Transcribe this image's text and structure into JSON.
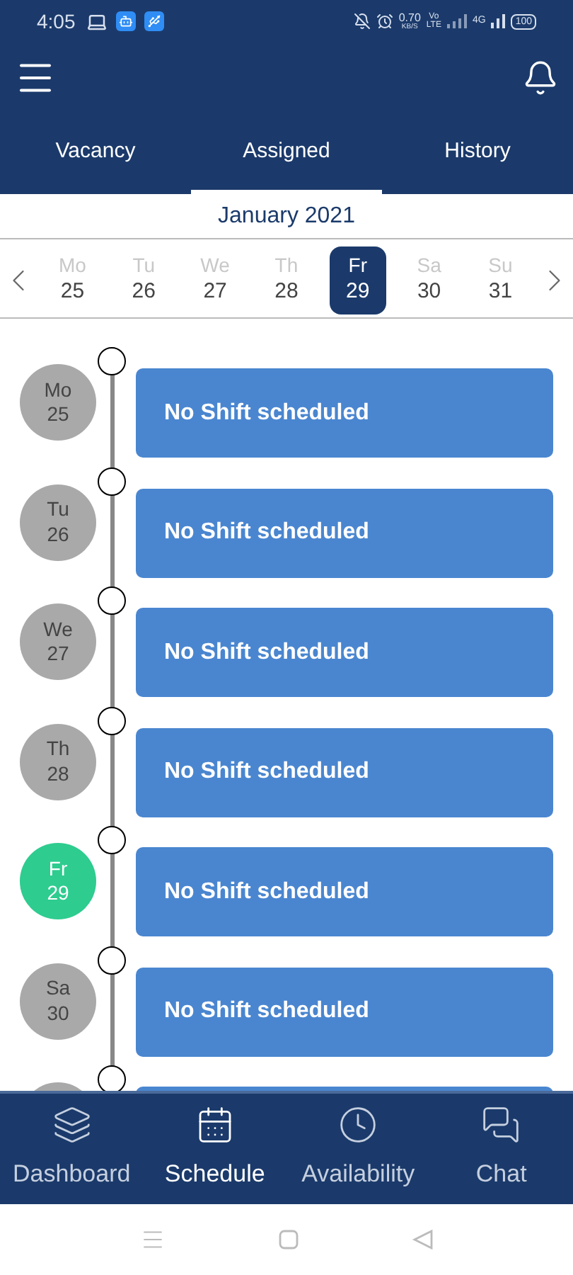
{
  "status_bar": {
    "time": "4:05",
    "speed": "0.70",
    "speed_unit": "KB/S",
    "volte_top": "Vo",
    "volte_bottom": "LTE",
    "network": "4G",
    "battery": "100"
  },
  "tabs": [
    {
      "label": "Vacancy",
      "selected": false
    },
    {
      "label": "Assigned",
      "selected": true
    },
    {
      "label": "History",
      "selected": false
    }
  ],
  "month": "January 2021",
  "week": [
    {
      "day": "Mo",
      "date": "25",
      "selected": false
    },
    {
      "day": "Tu",
      "date": "26",
      "selected": false
    },
    {
      "day": "We",
      "date": "27",
      "selected": false
    },
    {
      "day": "Th",
      "date": "28",
      "selected": false
    },
    {
      "day": "Fr",
      "date": "29",
      "selected": true
    },
    {
      "day": "Sa",
      "date": "30",
      "selected": false
    },
    {
      "day": "Su",
      "date": "31",
      "selected": false
    }
  ],
  "timeline": [
    {
      "kind": "full",
      "day": "Mo",
      "date": "25",
      "today": false,
      "label": "No Shift scheduled"
    },
    {
      "kind": "full",
      "day": "Tu",
      "date": "26",
      "today": false,
      "label": "No Shift scheduled"
    },
    {
      "kind": "full",
      "day": "We",
      "date": "27",
      "today": false,
      "label": "No Shift scheduled"
    },
    {
      "kind": "full",
      "day": "Th",
      "date": "28",
      "today": false,
      "label": "No Shift scheduled"
    },
    {
      "kind": "full",
      "day": "Fr",
      "date": "29",
      "today": true,
      "label": "No Shift scheduled"
    },
    {
      "kind": "full",
      "day": "Sa",
      "date": "30",
      "today": false,
      "label": "No Shift scheduled"
    },
    {
      "kind": "partial",
      "today": false
    }
  ],
  "nav": [
    {
      "label": "Dashboard",
      "kind": "layers",
      "selected": false
    },
    {
      "label": "Schedule",
      "kind": "calendar",
      "selected": true
    },
    {
      "label": "Availability",
      "kind": "clock",
      "selected": false
    },
    {
      "label": "Chat",
      "kind": "chat",
      "selected": false
    }
  ]
}
